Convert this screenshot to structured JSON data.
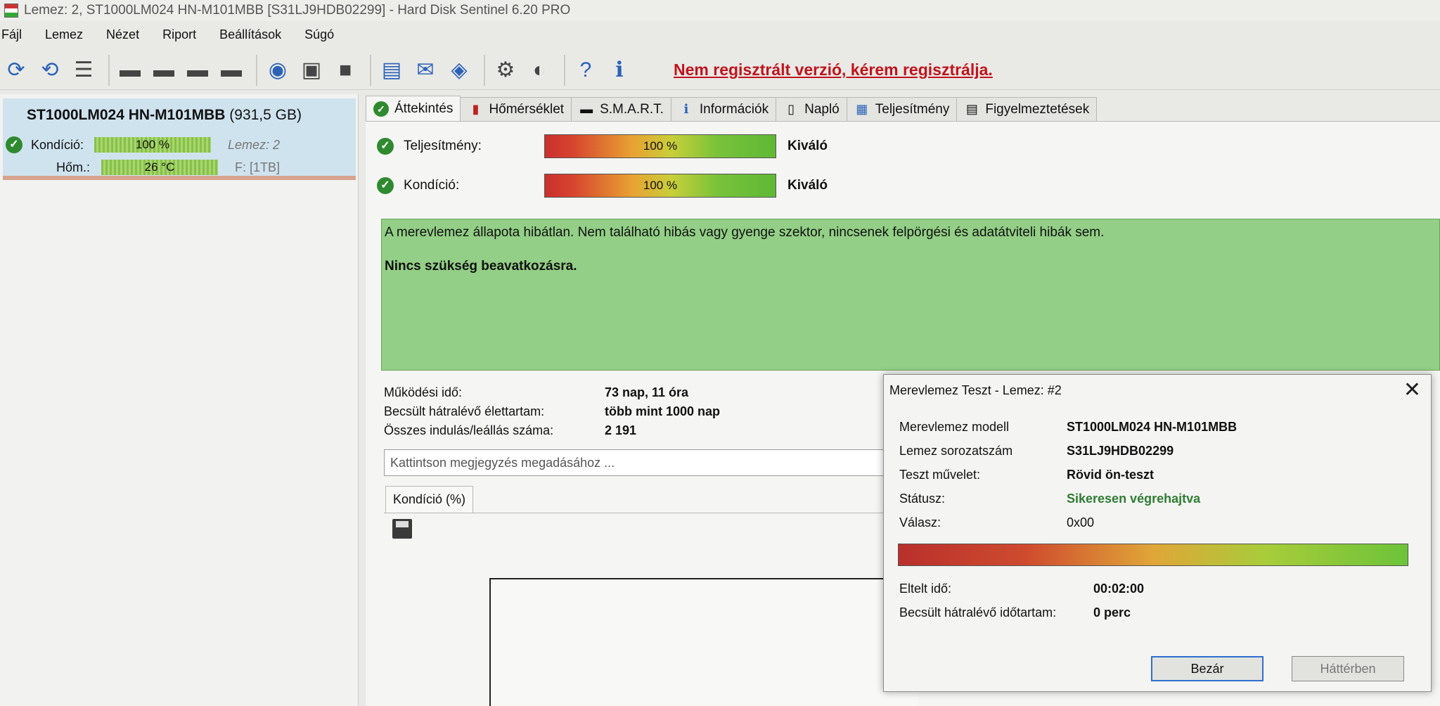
{
  "window": {
    "title": "Lemez: 2, ST1000LM024 HN-M101MBB [S31LJ9HDB02299]  -  Hard Disk Sentinel 6.20 PRO"
  },
  "menu": [
    "Fájl",
    "Lemez",
    "Nézet",
    "Riport",
    "Beállítások",
    "Súgó"
  ],
  "toolbar": {
    "register_text": "Nem regisztrált verzió, kérem regisztrálja."
  },
  "disk": {
    "name": "ST1000LM024 HN-M101MBB",
    "size": "(931,5 GB)",
    "condition_label": "Kondíció:",
    "condition_value": "100 %",
    "disk_label": "Lemez: 2",
    "temp_label": "Hőm.:",
    "temp_value": "26 °C",
    "volume": "F: [1TB]"
  },
  "tabs": [
    {
      "label": "Áttekintés",
      "icon": "check-icon"
    },
    {
      "label": "Hőmérséklet",
      "icon": "thermometer-icon"
    },
    {
      "label": "S.M.A.R.T.",
      "icon": "smart-icon"
    },
    {
      "label": "Információk",
      "icon": "info-icon"
    },
    {
      "label": "Napló",
      "icon": "log-icon"
    },
    {
      "label": "Teljesítmény",
      "icon": "chart-icon"
    },
    {
      "label": "Figyelmeztetések",
      "icon": "alerts-icon"
    }
  ],
  "overview": {
    "performance_label": "Teljesítmény:",
    "performance_value": "100 %",
    "performance_progress": 1.0,
    "performance_rating": "Kiváló",
    "health_label": "Kondíció:",
    "health_value": "100 %",
    "health_progress": 1.0,
    "health_rating": "Kiváló",
    "status_message": "A merevlemez állapota hibátlan. Nem található hibás vagy gyenge szektor, nincsenek felpörgési és adatátviteli hibák sem.",
    "action_message": "Nincs szükség beavatkozásra.",
    "stats": [
      {
        "key": "Működési idő:",
        "value": "73 nap, 11 óra"
      },
      {
        "key": "Becsült hátralévő élettartam:",
        "value": "több mint 1000 nap"
      },
      {
        "key": "Összes indulás/leállás száma:",
        "value": "2 191"
      }
    ],
    "comment_placeholder": "Kattintson megjegyzés megadásához ...",
    "subtab_label": "Kondíció  (%)"
  },
  "dialog": {
    "title": "Merevlemez Teszt - Lemez: #2",
    "model_label": "Merevlemez modell",
    "model_value": "ST1000LM024 HN-M101MBB",
    "serial_label": "Lemez sorozatszám",
    "serial_value": "S31LJ9HDB02299",
    "operation_label": "Teszt művelet:",
    "operation_value": "Rövid ön-teszt",
    "status_label": "Státusz:",
    "status_value": "Sikeresen végrehajtva",
    "response_label": "Válasz:",
    "response_value": "0x00",
    "progress": 1.0,
    "elapsed_label": "Eltelt idő:",
    "elapsed_value": "00:02:00",
    "remaining_label": "Becsült hátralévő időtartam:",
    "remaining_value": "0 perc",
    "close_button": "Bezár",
    "background_button": "Háttérben"
  },
  "colors": {
    "status_ok_bg": "#93cf86",
    "register_red": "#c0141b",
    "status_green": "#2e7d32"
  }
}
